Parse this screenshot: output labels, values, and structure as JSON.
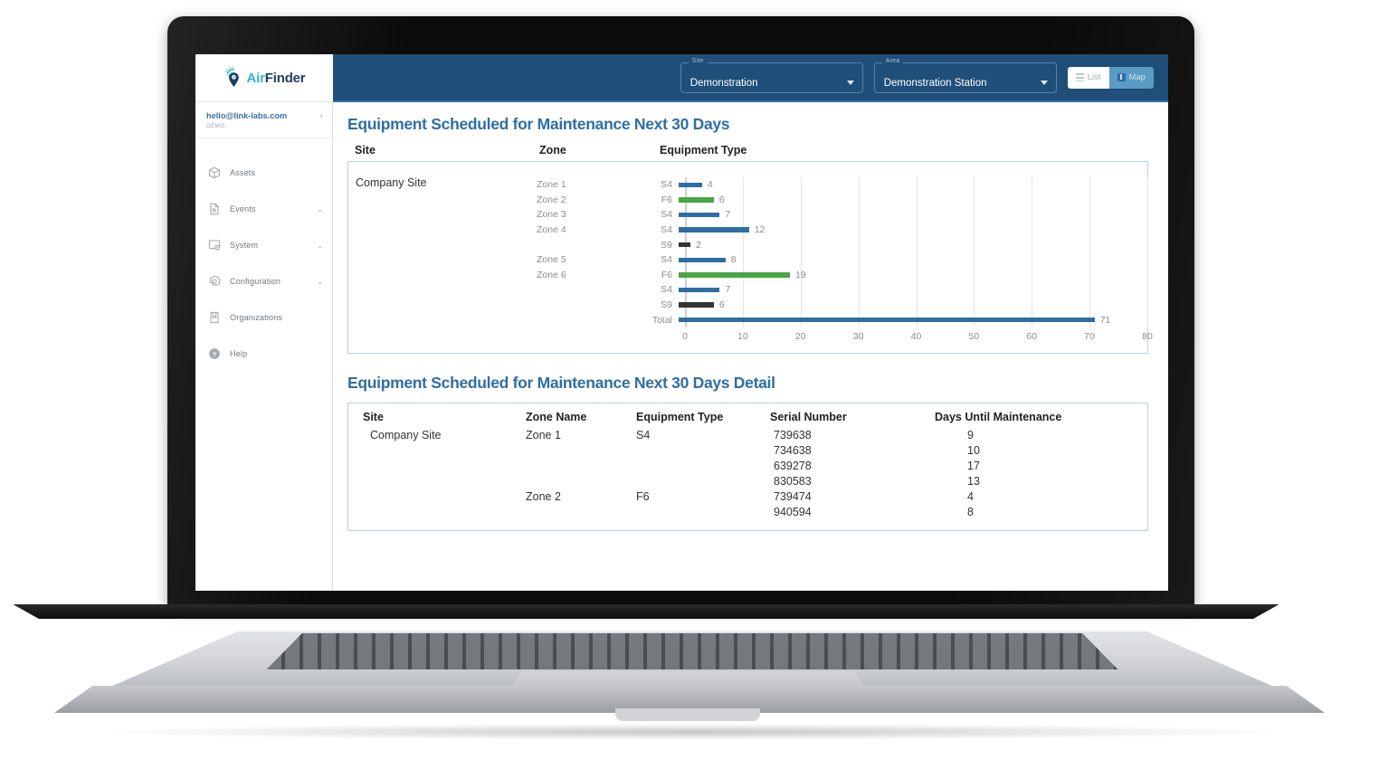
{
  "topbar": {
    "logo_air": "Air",
    "logo_finder": "Finder",
    "site_label": "Site",
    "site_value": "Demonstration",
    "area_label": "Area",
    "area_value": "Demonstration Station",
    "list_button": "List",
    "map_button": "Map"
  },
  "sidebar": {
    "user_email": "hello@link-labs.com",
    "user_role": "DEMO",
    "collapse": "‹",
    "items": [
      {
        "label": "Assets",
        "icon": "cube-icon",
        "caret": ""
      },
      {
        "label": "Events",
        "icon": "document-icon",
        "caret": "⌄"
      },
      {
        "label": "System",
        "icon": "monitor-gear-icon",
        "caret": "⌄"
      },
      {
        "label": "Configuration",
        "icon": "gear-icon",
        "caret": "⌄"
      },
      {
        "label": "Organizations",
        "icon": "book-icon",
        "caret": ""
      },
      {
        "label": "Help",
        "icon": "help-circle-icon",
        "caret": ""
      }
    ]
  },
  "main": {
    "chart_section_title": "Equipment Scheduled for Maintenance Next 30 Days",
    "detail_section_title": "Equipment Scheduled for Maintenance Next 30 Days Detail",
    "chart_headers": {
      "site": "Site",
      "zone": "Zone",
      "type": "Equipment Type"
    },
    "chart_site_value": "Company Site",
    "detail_headers": {
      "site": "Site",
      "zone": "Zone Name",
      "type": "Equipment Type",
      "serial": "Serial Number",
      "days": "Days Until Maintenance"
    },
    "detail_rows": [
      {
        "site": "Company Site",
        "zone": "Zone 1",
        "type": "S4",
        "serial": "739638",
        "days": "9"
      },
      {
        "site": "",
        "zone": "",
        "type": "",
        "serial": "734638",
        "days": "10"
      },
      {
        "site": "",
        "zone": "",
        "type": "",
        "serial": "639278",
        "days": "17"
      },
      {
        "site": "",
        "zone": "",
        "type": "",
        "serial": "830583",
        "days": "13"
      },
      {
        "site": "",
        "zone": "Zone 2",
        "type": "F6",
        "serial": "739474",
        "days": "4"
      },
      {
        "site": "",
        "zone": "",
        "type": "",
        "serial": "940594",
        "days": "8"
      }
    ]
  },
  "chart_data": {
    "type": "bar",
    "orientation": "horizontal",
    "title": "Equipment Scheduled for Maintenance Next 30 Days",
    "xlabel": "",
    "ylabel": "",
    "xlim": [
      0,
      80
    ],
    "xticks": [
      0,
      10,
      20,
      30,
      40,
      50,
      60,
      70,
      80
    ],
    "grid": true,
    "legend": "none",
    "site": "Company Site",
    "colors": {
      "S4": "#2e6ea5",
      "F6": "#4aa545",
      "S9": "#333333",
      "Total": "#2e6ea5"
    },
    "zone_labels": [
      "Zone 1",
      "Zone 2",
      "Zone 3",
      "Zone 4",
      "",
      "Zone 5",
      "Zone 6",
      "",
      "",
      ""
    ],
    "categories": [
      "S4",
      "F6",
      "S4",
      "S4",
      "S9",
      "S4",
      "F6",
      "S4",
      "S9",
      "Total"
    ],
    "values": [
      4,
      6,
      7,
      12,
      2,
      8,
      19,
      7,
      6,
      71
    ],
    "rows": [
      {
        "zone": "Zone 1",
        "type": "S4",
        "value": 4,
        "color": "#2e6ea5"
      },
      {
        "zone": "Zone 2",
        "type": "F6",
        "value": 6,
        "color": "#4aa545"
      },
      {
        "zone": "Zone 3",
        "type": "S4",
        "value": 7,
        "color": "#2e6ea5"
      },
      {
        "zone": "Zone 4",
        "type": "S4",
        "value": 12,
        "color": "#2e6ea5"
      },
      {
        "zone": "",
        "type": "S9",
        "value": 2,
        "color": "#333333"
      },
      {
        "zone": "Zone 5",
        "type": "S4",
        "value": 8,
        "color": "#2e6ea5"
      },
      {
        "zone": "Zone 6",
        "type": "F6",
        "value": 19,
        "color": "#4aa545"
      },
      {
        "zone": "",
        "type": "S4",
        "value": 7,
        "color": "#2e6ea5"
      },
      {
        "zone": "",
        "type": "S9",
        "value": 6,
        "color": "#333333"
      },
      {
        "zone": "",
        "type": "Total",
        "value": 71,
        "color": "#2e6ea5"
      }
    ]
  }
}
